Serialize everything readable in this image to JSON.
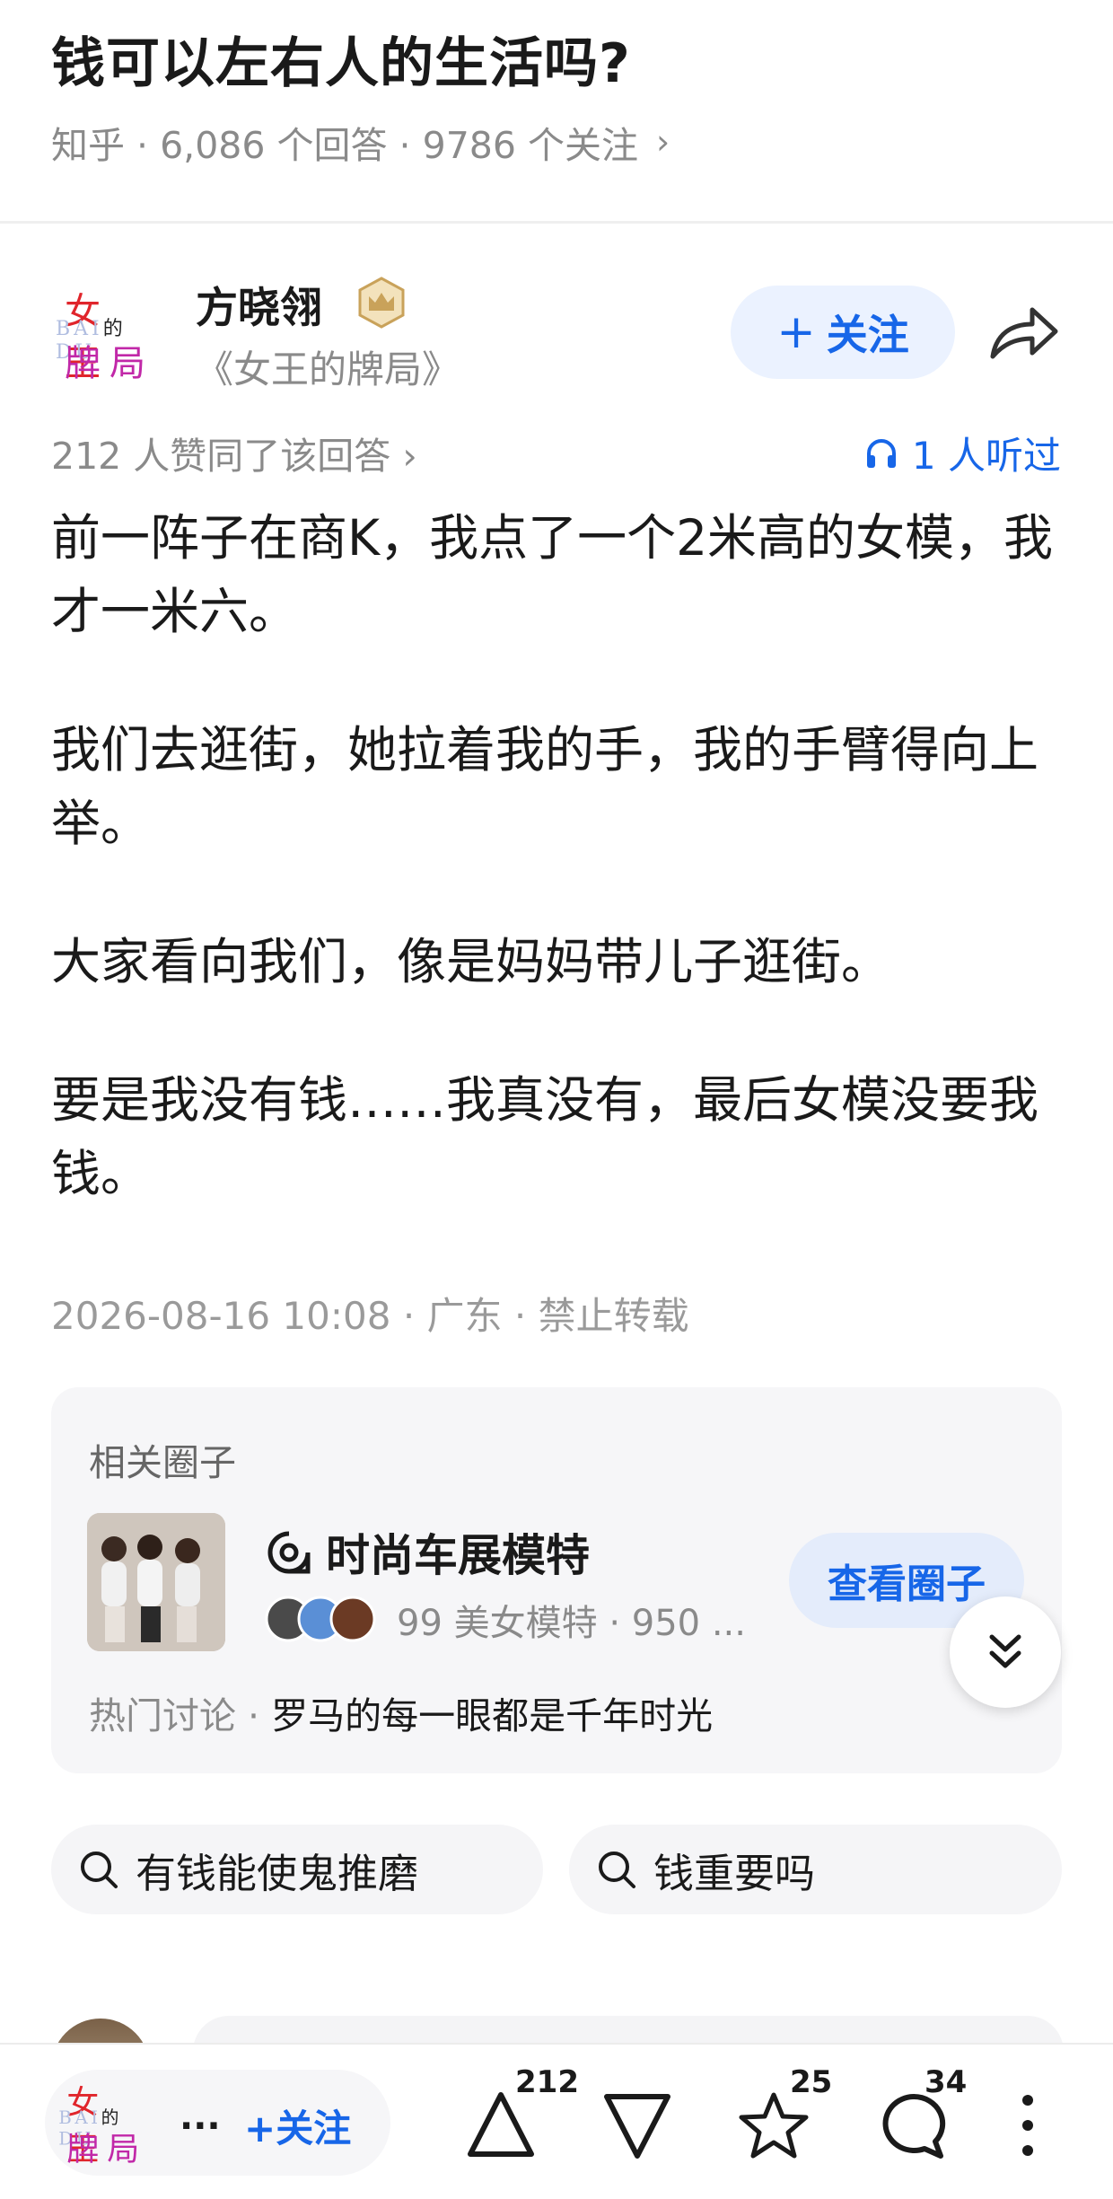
{
  "question": {
    "title": "钱可以左右人的生活吗?",
    "meta": "知乎 · 6,086 个回答 · 9786 个关注",
    "chevron": "›"
  },
  "author": {
    "logo_top": "女王",
    "logo_mid": "BAI的DU",
    "logo_mid_left": "BAI",
    "logo_mid_de": "的",
    "logo_mid_right": "DU",
    "logo_bottom": "牌局",
    "name": "方晓翎",
    "bio": "《女王的牌局》",
    "follow_label": "关注",
    "follow_plus": "+"
  },
  "answer": {
    "votes_text": "212 人赞同了该回答 ›",
    "listen_text": "1 人听过",
    "paragraphs": [
      "前一阵子在商K，我点了一个2米高的女模，我才一米六。",
      "我们去逛街，她拉着我的手，我的手臂得向上举。",
      "大家看向我们，像是妈妈带儿子逛街。",
      "要是我没有钱……我真没有，最后女模没要我钱。"
    ],
    "timestamp": "2026-08-16 10:08 · 广东 · 禁止转载"
  },
  "circle": {
    "section_title": "相关圈子",
    "name": "时尚车展模特",
    "stats": "99 美女模特 · 950 ...",
    "view_label": "查看圈子",
    "hot_prefix": "热门讨论 · ",
    "hot_topic": "罗马的每一眼都是千年时光"
  },
  "searches": [
    {
      "label": "有钱能使鬼推磨"
    },
    {
      "label": "钱重要吗"
    }
  ],
  "bottom_bar": {
    "user_ellipsis": "...",
    "follow_label": "+关注",
    "upvote_count": "212",
    "star_count": "25",
    "comment_count": "34"
  },
  "colors": {
    "accent_blue": "#1766e8",
    "follow_bg": "#ebf2ff",
    "muted_text": "#8a8a8a",
    "badge_gold": "#c9a25a"
  },
  "icons": {
    "share": "share-icon",
    "headphones": "headphones-icon",
    "badge": "crown-badge-icon",
    "circle": "circle-icon",
    "search": "search-icon",
    "chevron_down": "double-chevron-down-icon",
    "upvote": "upvote-icon",
    "downvote": "downvote-icon",
    "star": "star-icon",
    "comment": "comment-icon",
    "more": "more-icon"
  }
}
